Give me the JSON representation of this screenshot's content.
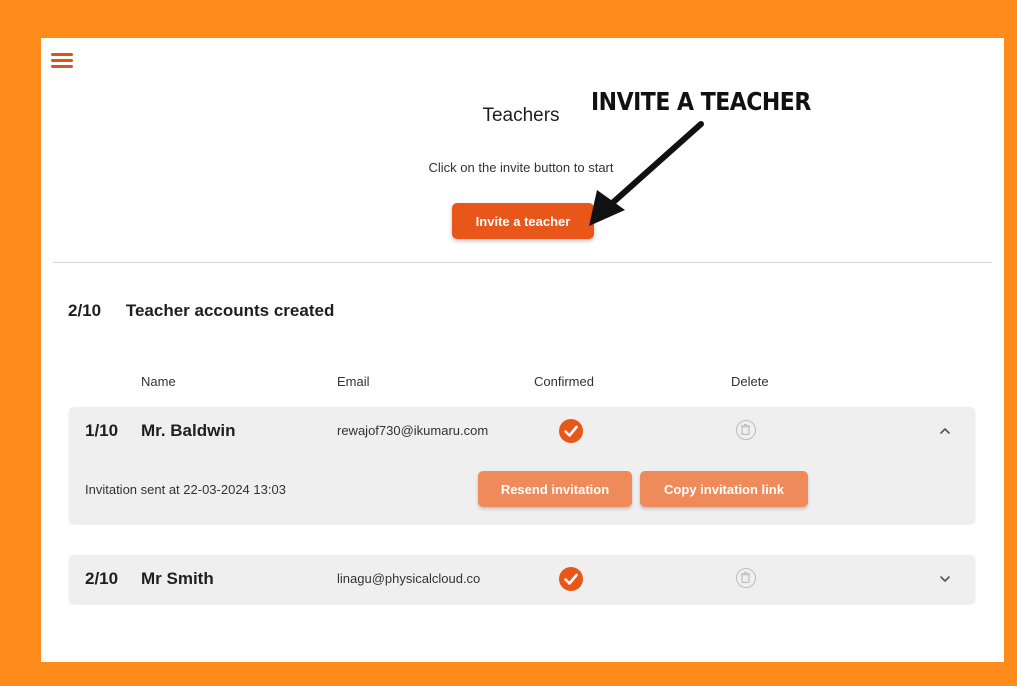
{
  "header": {
    "title": "Teachers",
    "hint": "Click on the invite button to start",
    "invite_label": "Invite a teacher"
  },
  "callout": {
    "text": "INVITE A TEACHER"
  },
  "summary": {
    "count": "2/10",
    "label": "Teacher accounts created"
  },
  "columns": {
    "name": "Name",
    "email": "Email",
    "confirmed": "Confirmed",
    "delete": "Delete"
  },
  "teachers": [
    {
      "index": "1/10",
      "name": "Mr. Baldwin",
      "email": "rewajof730@ikumaru.com",
      "invitation_sent": "Invitation sent at 22-03-2024 13:03",
      "resend_label": "Resend invitation",
      "copy_label": "Copy invitation link"
    },
    {
      "index": "2/10",
      "name": "Mr Smith",
      "email": "linagu@physicalcloud.co"
    }
  ],
  "colors": {
    "accent": "#e8561a",
    "accent_light": "#ef8a5b",
    "frame_border": "#ff8c1a"
  },
  "icons": {
    "menu": "hamburger-menu-icon",
    "confirmed": "check-circle-icon",
    "delete": "trash-icon",
    "expand": "chevron-down-icon",
    "collapse": "chevron-up-icon"
  }
}
